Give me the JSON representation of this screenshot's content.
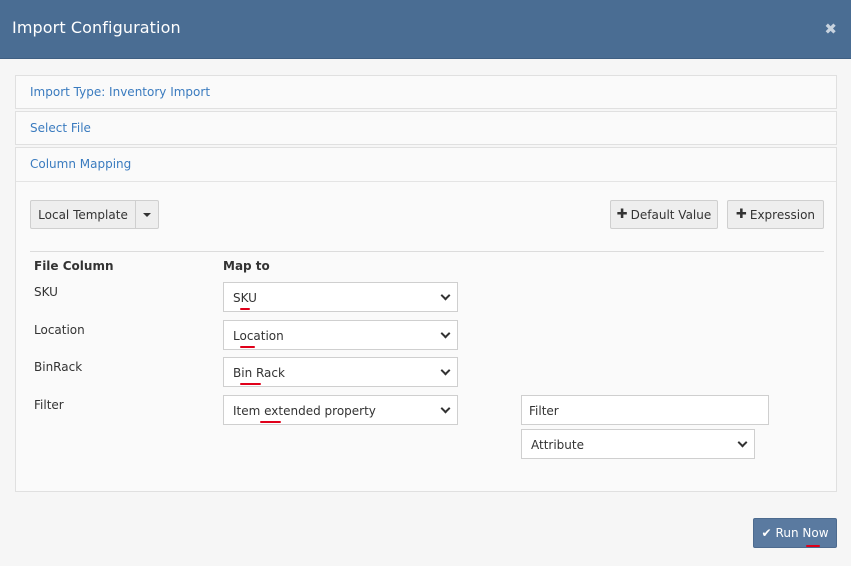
{
  "window": {
    "title": "Import Configuration",
    "close_glyph": "✖"
  },
  "panels": {
    "import_type": "Import Type: Inventory Import",
    "select_file": "Select File",
    "column_mapping": "Column Mapping"
  },
  "toolbar": {
    "local_template": "Local Template",
    "default_value": "Default Value",
    "expression": "Expression",
    "plus_glyph": "✚"
  },
  "mapping": {
    "header_file_column": "File Column",
    "header_map_to": "Map to",
    "rows": [
      {
        "file_column": "SKU",
        "map_to": "SKU"
      },
      {
        "file_column": "Location",
        "map_to": "Location"
      },
      {
        "file_column": "BinRack",
        "map_to": "Bin Rack"
      },
      {
        "file_column": "Filter",
        "map_to": "Item extended property"
      }
    ],
    "filter_input_value": "Filter",
    "filter_attribute_select": "Attribute"
  },
  "footer": {
    "run_now": "Run Now",
    "check_glyph": "✔"
  },
  "colors": {
    "header_bg": "#4a6d93",
    "link": "#3a7bbf",
    "primary_btn": "#5a7aa0",
    "spell_underline": "#e0001a"
  }
}
